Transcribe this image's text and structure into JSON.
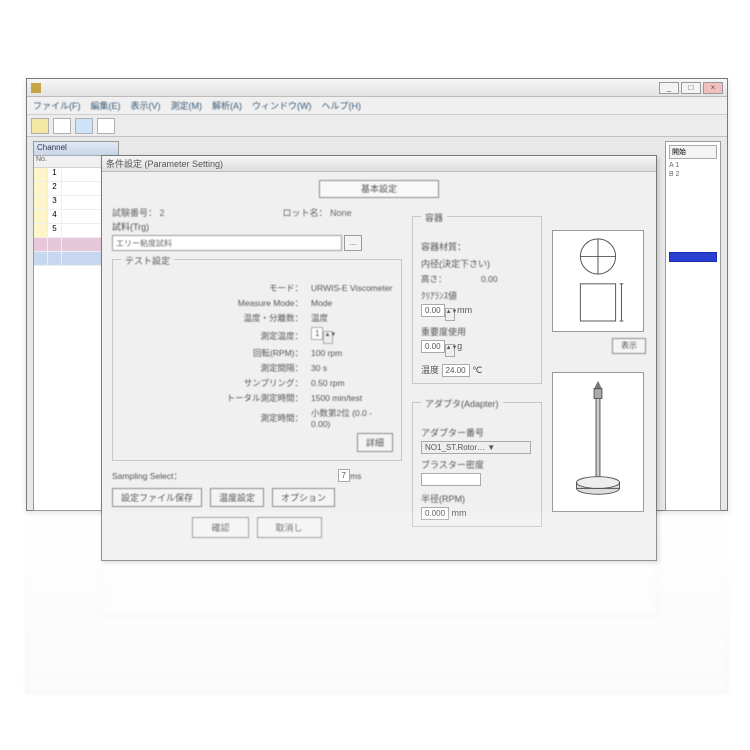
{
  "window": {
    "title": "",
    "minimize": "_",
    "maximize": "□",
    "close": "×"
  },
  "menubar": {
    "items": [
      "ファイル(F)",
      "編集(E)",
      "表示(V)",
      "測定(M)",
      "解析(A)",
      "ウィンドウ(W)",
      "ヘルプ(H)"
    ]
  },
  "child": {
    "title": "Channel",
    "header": "No.",
    "rows": [
      "1",
      "2",
      "3",
      "4",
      "5"
    ]
  },
  "rpanel": {
    "btn": "開始",
    "rows": [
      "A  1",
      "B  2"
    ]
  },
  "dialog": {
    "title": "条件設定 (Parameter Setting)",
    "top_button": "基本設定",
    "test_no_label": "試験番号：",
    "test_no_value": "2",
    "lot_label": "ロット名：",
    "lot_value": "None",
    "sample_label": "試料(Trg)",
    "sample_input": "エリー粘度試料",
    "browse": "...",
    "test_group_label": "テスト設定",
    "kv": [
      {
        "k": "モード：",
        "v": "URWIS-E   Viscometer"
      },
      {
        "k": "Measure Mode：",
        "v": "Mode"
      },
      {
        "k": "温度・分離数：",
        "v": "温度"
      },
      {
        "k": "測定温度：",
        "v": "1",
        "spin": true,
        "unit": ""
      },
      {
        "k": "回転(RPM)：",
        "v": "100",
        "unit": "rpm"
      },
      {
        "k": "測定間隔：",
        "v": "30",
        "unit": "s"
      },
      {
        "k": "サンプリング：",
        "v": "0.50",
        "unit": "rpm"
      },
      {
        "k": "トータル測定時間：",
        "v": "1500",
        "unit": "min/test"
      },
      {
        "k": "測定時間：",
        "v": "小数第2位 (0.0 - 0.00)"
      }
    ],
    "detail_btn": "詳細",
    "sampling_label": "Sampling Select：",
    "sampling_value": "7",
    "sampling_unit": "ms",
    "bottom_buttons": [
      "設定ファイル保存",
      "温度設定",
      "オプション"
    ],
    "confirm_buttons": [
      "確認",
      "取消し"
    ],
    "right_group1": {
      "label": "容器",
      "lines": [
        "容器材質：",
        "内径(決定下さい)"
      ],
      "height_label": "高さ：",
      "height_value": "0.00",
      "clear_label": "ｸﾘｱﾗﾝｽ値",
      "clear_value": "0.00",
      "clear_unit": "mm",
      "amount_label": "重要度使用",
      "amount_value": "0.00",
      "amount_unit": "g",
      "temp_label": "温度",
      "temp_value": "24.00",
      "temp_unit": "℃"
    },
    "right_group2": {
      "label": "アダプタ(Adapter)",
      "adapter_label": "アダプター番号",
      "adapter_value": "NO1_ST.Rotor… ▼",
      "aux_label": "ブラスター密度",
      "aux_value": "",
      "val_label": "半径(RPM)",
      "val_value": "0.000",
      "val_unit": "mm"
    },
    "diag_btn": "表示"
  }
}
